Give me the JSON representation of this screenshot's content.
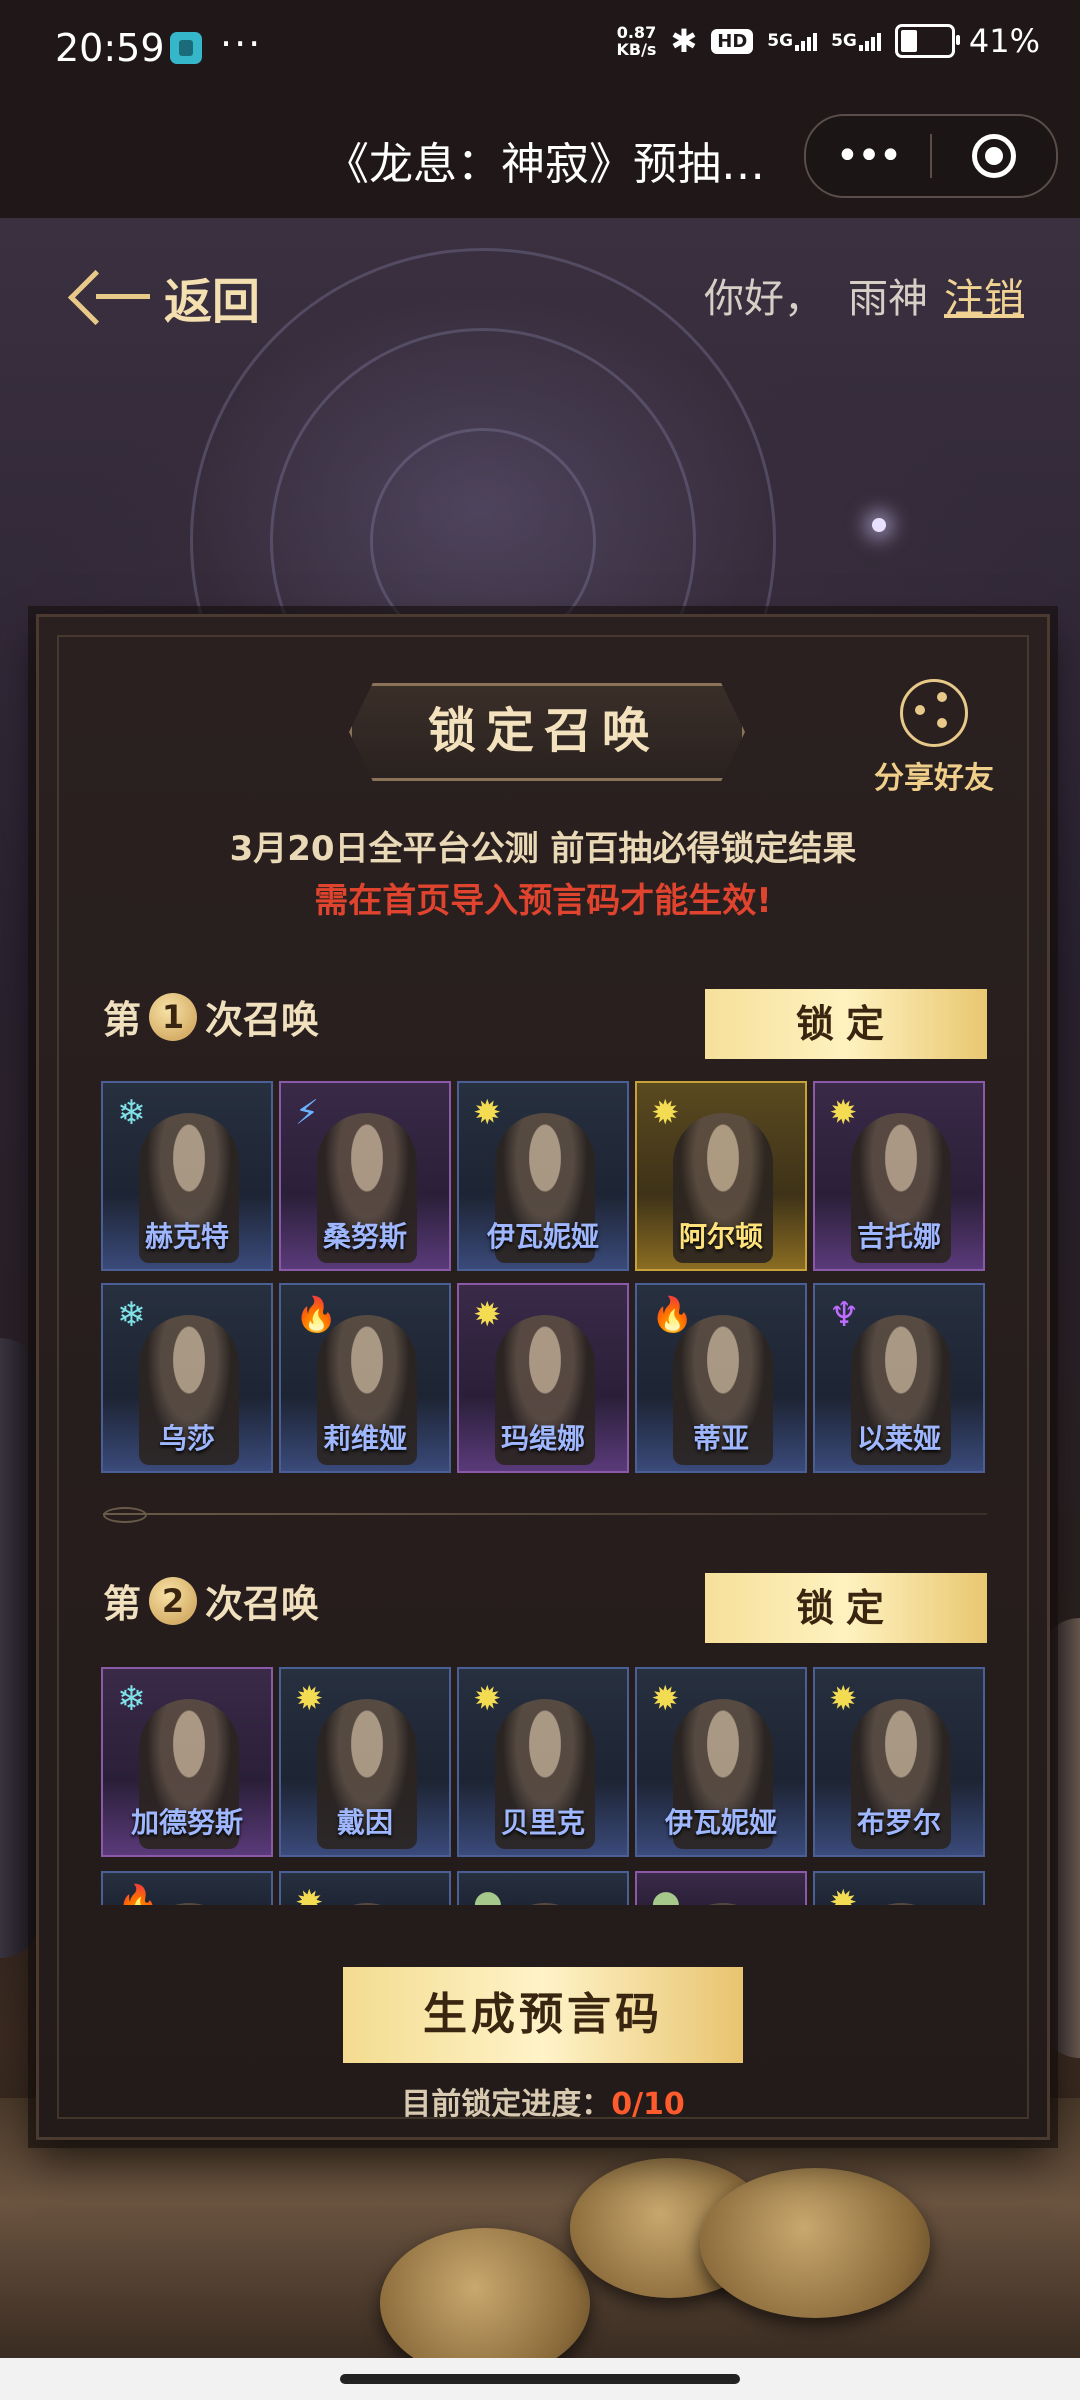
{
  "status_bar": {
    "time": "20:59",
    "more": "···",
    "net_speed_value": "0.87",
    "net_speed_unit": "KB/s",
    "hd_badge": "HD",
    "signal1": "5G",
    "signal2": "5G",
    "battery": "41%"
  },
  "header": {
    "title": "《龙息：神寂》预抽…",
    "more_icon": "•••"
  },
  "page": {
    "back_label": "返回",
    "greeting": "你好，",
    "username": "雨神",
    "logout": "注销"
  },
  "panel": {
    "title": "锁定召唤",
    "share_label": "分享好友",
    "info_line": "3月20日全平台公测 前百抽必得锁定结果",
    "warning_line": "需在首页导入预言码才能生效!",
    "rounds": [
      {
        "prefix": "第",
        "number": "1",
        "suffix": "次召唤",
        "lock_label": "锁定",
        "heroes": [
          {
            "name": "赫克特",
            "element": "ice",
            "frame": "blue"
          },
          {
            "name": "桑努斯",
            "element": "bolt",
            "frame": "purple"
          },
          {
            "name": "伊瓦妮娅",
            "element": "sun",
            "frame": "blue"
          },
          {
            "name": "阿尔顿",
            "element": "sun",
            "frame": "gold"
          },
          {
            "name": "吉托娜",
            "element": "sun",
            "frame": "purple"
          },
          {
            "name": "乌莎",
            "element": "ice",
            "frame": "blue"
          },
          {
            "name": "莉维娅",
            "element": "fire",
            "frame": "blue"
          },
          {
            "name": "玛缇娜",
            "element": "sun",
            "frame": "purple"
          },
          {
            "name": "蒂亚",
            "element": "fire",
            "frame": "blue"
          },
          {
            "name": "以莱娅",
            "element": "demon",
            "frame": "blue"
          }
        ]
      },
      {
        "prefix": "第",
        "number": "2",
        "suffix": "次召唤",
        "lock_label": "锁定",
        "heroes": [
          {
            "name": "加德努斯",
            "element": "ice",
            "frame": "purple"
          },
          {
            "name": "戴因",
            "element": "sun",
            "frame": "blue"
          },
          {
            "name": "贝里克",
            "element": "sun",
            "frame": "blue"
          },
          {
            "name": "伊瓦妮娅",
            "element": "sun",
            "frame": "blue"
          },
          {
            "name": "布罗尔",
            "element": "sun",
            "frame": "blue"
          }
        ],
        "partial_heroes": [
          {
            "element": "fire",
            "frame": "blue"
          },
          {
            "element": "sun",
            "frame": "blue"
          },
          {
            "element": "slime",
            "frame": "blue"
          },
          {
            "element": "slime",
            "frame": "purple"
          },
          {
            "element": "sun",
            "frame": "blue"
          }
        ]
      }
    ],
    "generate_button": "生成预言码",
    "progress_label": "目前锁定进度：",
    "progress_value": "0/10"
  },
  "element_glyphs": {
    "ice": "❄",
    "sun": "✹",
    "bolt": "⚡",
    "fire": "🔥",
    "demon": "♆",
    "slime": "●"
  },
  "colors": {
    "accent_gold": "#f0d292",
    "warning_red": "#e0442e",
    "progress_red": "#ff5b2c",
    "hero_name_blue": "#9fb7ff"
  }
}
